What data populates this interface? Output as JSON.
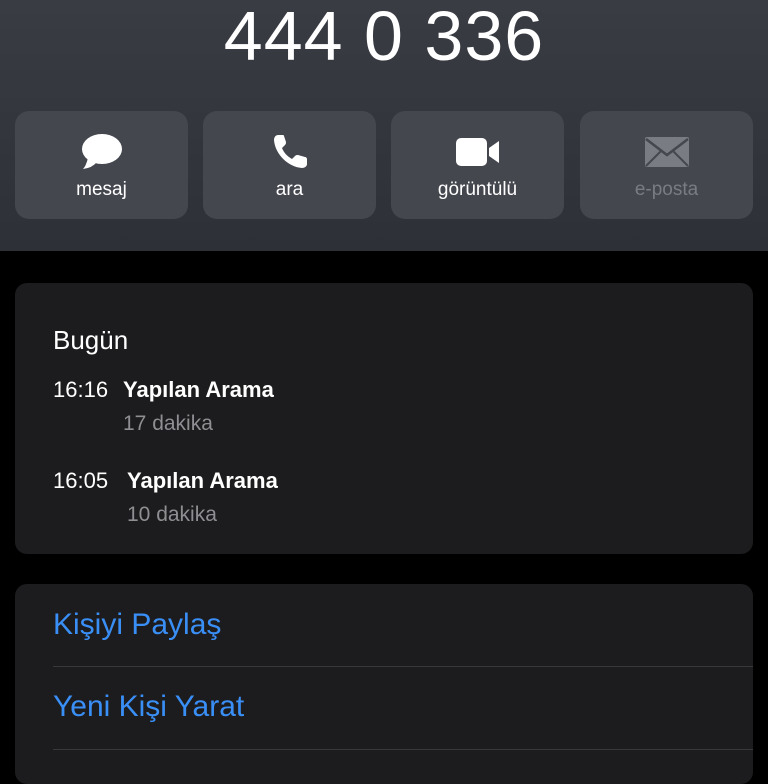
{
  "contact": {
    "number": "444 0 336"
  },
  "actions": [
    {
      "label": "mesaj",
      "icon": "message-icon",
      "enabled": true
    },
    {
      "label": "ara",
      "icon": "phone-icon",
      "enabled": true
    },
    {
      "label": "görüntülü",
      "icon": "video-icon",
      "enabled": true
    },
    {
      "label": "e-posta",
      "icon": "mail-icon",
      "enabled": false
    }
  ],
  "recents": {
    "day": "Bugün",
    "calls": [
      {
        "time": "16:16",
        "type": "Yapılan Arama",
        "duration": "17 dakika"
      },
      {
        "time": "16:05",
        "type": "Yapılan Arama",
        "duration": "10 dakika"
      }
    ]
  },
  "options": [
    {
      "label": "Kişiyi Paylaş"
    },
    {
      "label": "Yeni Kişi Yarat"
    }
  ],
  "colors": {
    "accent": "#3a8ff7",
    "card": "#1c1c1e",
    "button": "#45474f",
    "secondary_text": "#8e8e93"
  }
}
